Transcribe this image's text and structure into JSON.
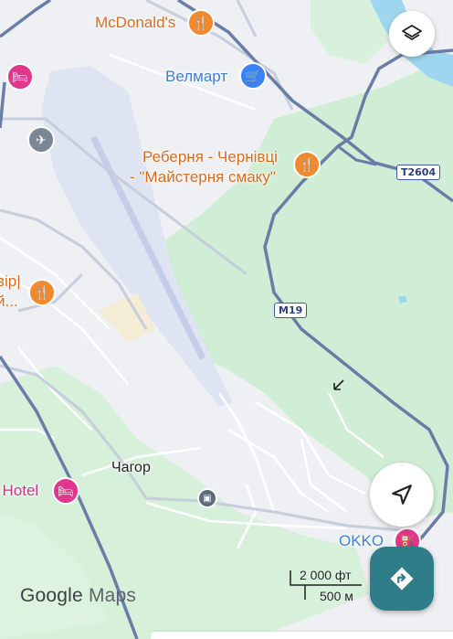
{
  "pois": {
    "mcdonalds": "McDonald's",
    "velmart": "Велмарт",
    "reberna_line1": "Реберня - Чернівці",
    "reberna_line2": "- \"Майстерня смаку\"",
    "left_cut_line1": "вір|",
    "left_cut_line2": "й...",
    "hotel": "i Hotel",
    "okko": "OKKO"
  },
  "places": {
    "chahor": "Чагор"
  },
  "road_shields": {
    "t2604": "T2604",
    "m19": "M19"
  },
  "scale": {
    "feet": "2 000 фт",
    "meters": "500 м"
  },
  "branding": {
    "google": "Google",
    "maps": "Maps"
  },
  "icons": {
    "layers": "layers-icon",
    "recenter": "navigation-arrow-icon",
    "directions": "directions-icon",
    "food": "fork-knife-icon",
    "shop": "shopping-cart-icon",
    "hotel": "bed-icon",
    "airport": "airplane-icon",
    "fuel": "fuel-pump-icon",
    "bus": "bus-stop-icon"
  },
  "colors": {
    "forest": "#cfeed5",
    "water": "#9fd6ef",
    "road_major": "#6a7da6",
    "accent_teal": "#2e7d88"
  }
}
